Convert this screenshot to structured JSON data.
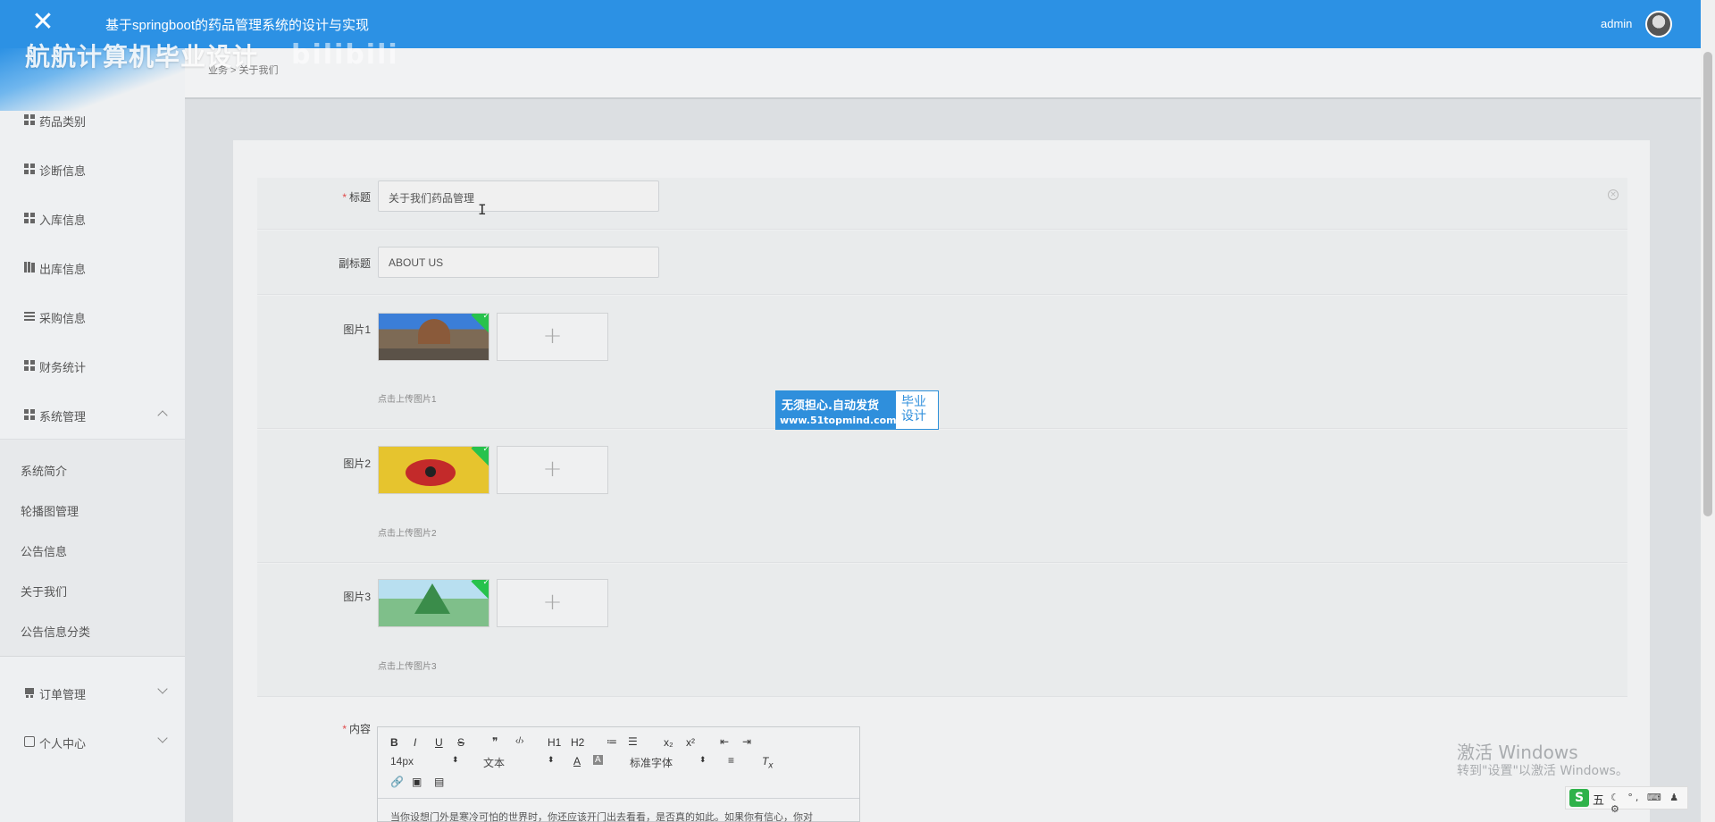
{
  "header": {
    "title": "基于springboot的药品管理系统的设计与实现",
    "user": "admin"
  },
  "watermark": {
    "text": "航航计算机毕业设计",
    "tail": "bilibili"
  },
  "sidebar": {
    "items": [
      {
        "label": "药品类别",
        "icon": "grid-icon"
      },
      {
        "label": "诊断信息",
        "icon": "grid-icon"
      },
      {
        "label": "入库信息",
        "icon": "grid-icon"
      },
      {
        "label": "出库信息",
        "icon": "bars-icon"
      },
      {
        "label": "采购信息",
        "icon": "list-icon"
      },
      {
        "label": "财务统计",
        "icon": "grid-icon"
      },
      {
        "label": "系统管理",
        "icon": "grid-icon",
        "expanded": true
      }
    ],
    "submenu": [
      "系统简介",
      "轮播图管理",
      "公告信息",
      "关于我们",
      "公告信息分类"
    ],
    "bottom_items": [
      {
        "label": "订单管理",
        "icon": "cart-icon"
      },
      {
        "label": "个人中心",
        "icon": "user-icon"
      }
    ]
  },
  "breadcrumb": "业务 > 关于我们",
  "form": {
    "title_label": "标题",
    "title_value": "关于我们药品管理",
    "subtitle_label": "副标题",
    "subtitle_value": "ABOUT US",
    "images": [
      {
        "label": "图片1",
        "hint": "点击上传图片1"
      },
      {
        "label": "图片2",
        "hint": "点击上传图片2"
      },
      {
        "label": "图片3",
        "hint": "点击上传图片3"
      }
    ],
    "upload_plus": "+",
    "content_label": "内容",
    "required_mark": "*"
  },
  "editor": {
    "toolbar_row1": [
      "B",
      "I",
      "U",
      "S",
      "❞",
      "‹/›",
      "H1",
      "H2",
      "≔",
      "☰",
      "x₂",
      "x²",
      "⇤",
      "⇥"
    ],
    "font_size": "14px",
    "block_type": "文本",
    "font_family": "标准字体",
    "body_text": "当你设想门外是寒冷可怕的世界时，你还应该开门出去看看，是否真的如此。如果你有信心，你对"
  },
  "ad": {
    "line1": "无须担心.自动发货",
    "line2": "www.51topmind.com",
    "badge": "毕业\n设计"
  },
  "windows_activation": {
    "line1": "激活 Windows",
    "line2": "转到\"设置\"以激活 Windows。"
  },
  "ime": {
    "logo": "S",
    "mode": "五"
  }
}
